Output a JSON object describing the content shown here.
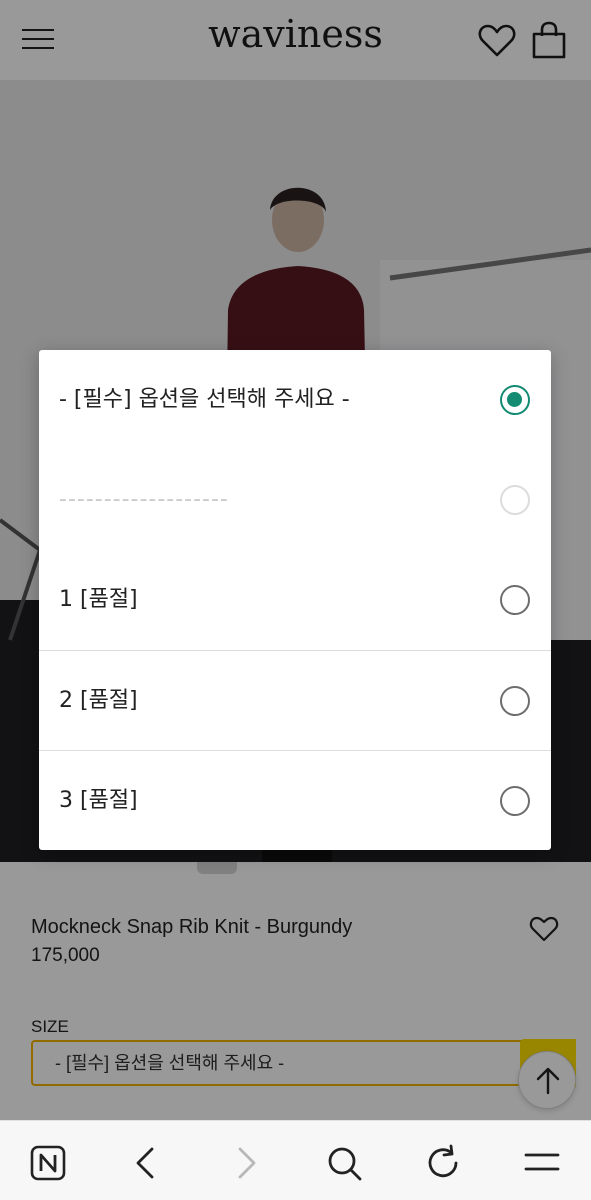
{
  "header": {
    "logo": "waviness",
    "icons": [
      "menu-icon",
      "heart-icon",
      "shopping-bag-icon"
    ]
  },
  "product": {
    "name": "Mockneck Snap Rib Knit - Burgundy",
    "price": "175,000",
    "size_label": "SIZE",
    "size_select_value": "- [필수] 옵션을 선택해 주세요 -"
  },
  "option_dialog": {
    "options": [
      {
        "label": "- [필수] 옵션을 선택해 주세요 -",
        "selected": true,
        "enabled": true
      },
      {
        "label": "-------------------",
        "selected": false,
        "enabled": false
      },
      {
        "label": "1 [품절]",
        "selected": false,
        "enabled": true
      },
      {
        "label": "2 [품절]",
        "selected": false,
        "enabled": true
      },
      {
        "label": "3 [품절]",
        "selected": false,
        "enabled": true
      }
    ]
  },
  "browser_bar": {
    "icons": [
      "naver-n-icon",
      "back-arrow-icon",
      "forward-arrow-icon",
      "search-icon",
      "refresh-icon",
      "menu-icon"
    ]
  },
  "colors": {
    "accent_radio": "#138a72",
    "size_select_border": "#f2b100",
    "yellow_tab": "#ffe000"
  }
}
